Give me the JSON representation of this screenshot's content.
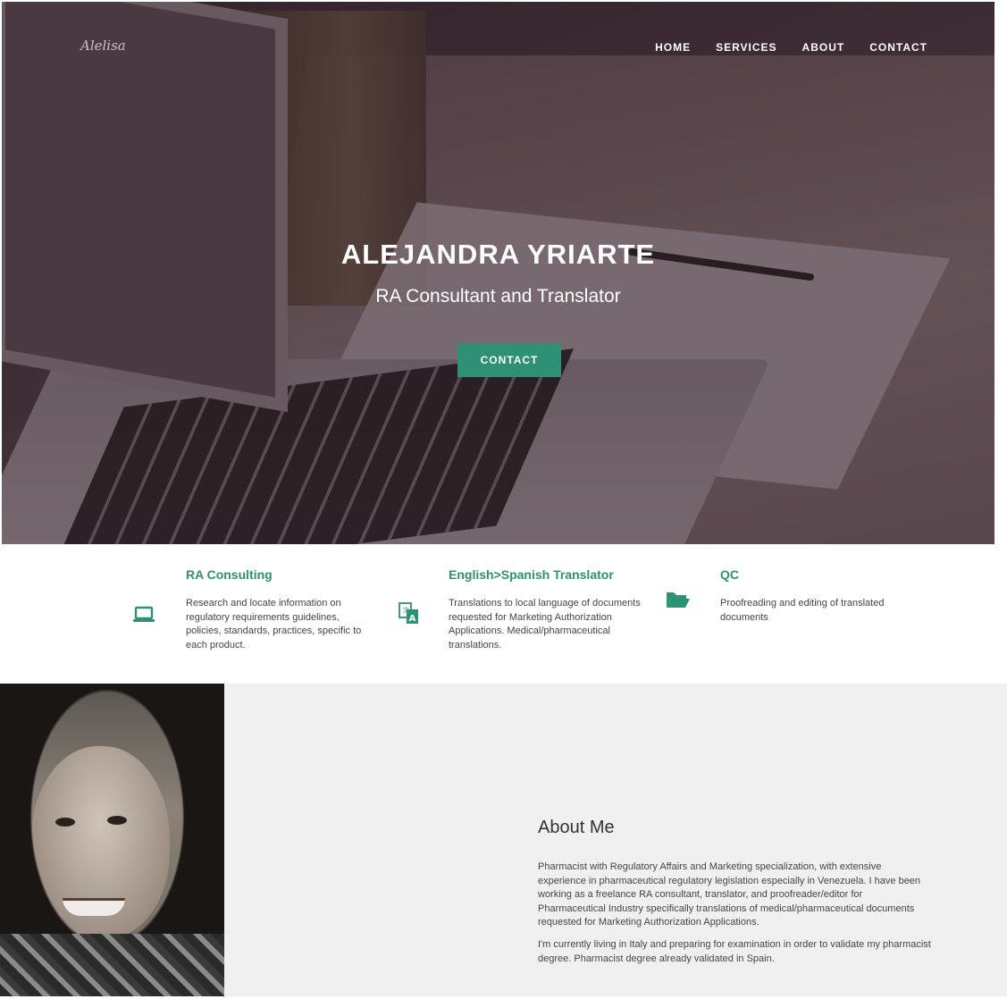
{
  "header": {
    "logo": "Alelisa",
    "nav": [
      "HOME",
      "SERVICES",
      "ABOUT",
      "CONTACT"
    ]
  },
  "hero": {
    "title": "ALEJANDRA YRIARTE",
    "subtitle": "RA Consultant and Translator",
    "button": "CONTACT"
  },
  "services": [
    {
      "icon": "laptop-icon",
      "title": "RA Consulting",
      "text": "Research and locate information on regulatory requirements guidelines, policies, standards, practices, specific to each product."
    },
    {
      "icon": "translate-icon",
      "title": "English>Spanish Translator",
      "text": "Translations to local language of documents requested for Marketing Authorization Applications. Medical/pharmaceutical translations."
    },
    {
      "icon": "folder-open-icon",
      "title": "QC",
      "text": "Proofreading and editing of translated documents"
    }
  ],
  "about": {
    "title": "About Me",
    "p1": "Pharmacist with Regulatory Affairs and Marketing specialization, with extensive experience in pharmaceutical regulatory legislation especially in Venezuela. I have been working as a freelance RA consultant, translator, and proofreader/editor for Pharmaceutical Industry specifically translations of medical/pharmaceutical documents requested for Marketing Authorization Applications.",
    "p2": "I'm currently living in Italy and preparing for examination in order to validate my pharmacist degree. Pharmacist degree already validated in Spain."
  },
  "colors": {
    "accent": "#2e9075",
    "about_bg": "#f0f0f0"
  }
}
